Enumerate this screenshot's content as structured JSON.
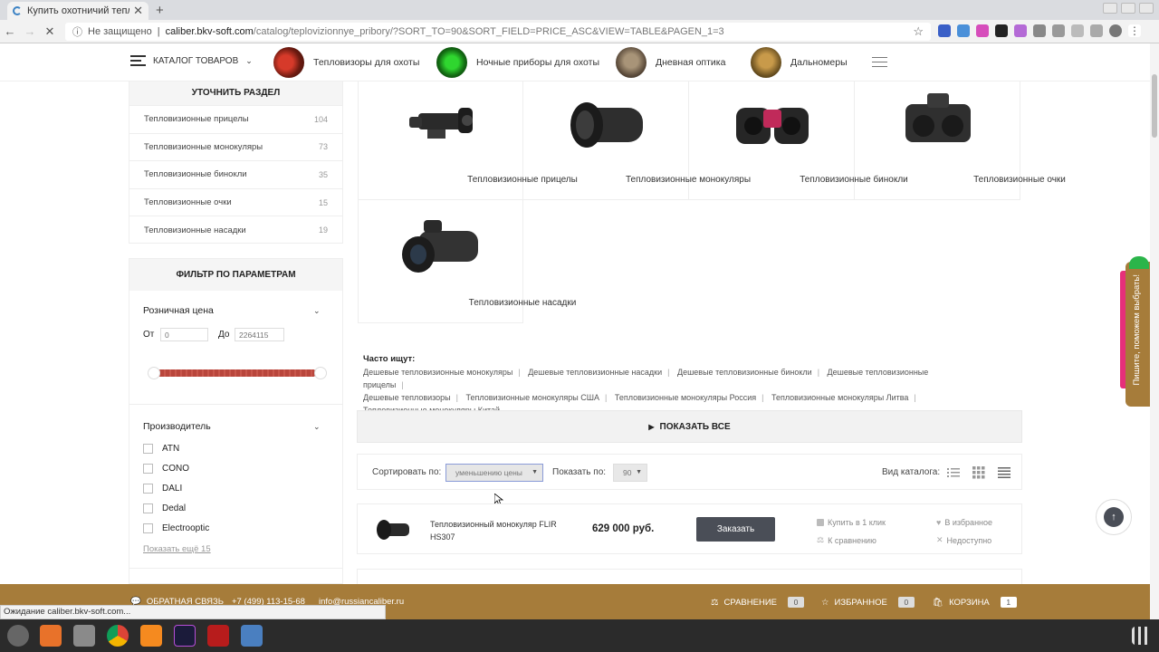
{
  "browser": {
    "tab_title": "Купить охотничий тепло",
    "new_tab": "+",
    "insecure_label": "Не защищено",
    "url_host": "caliber.bkv-soft.com",
    "url_path": "/catalog/teplovizionnye_pribory/?SORT_TO=90&SORT_FIELD=PRICE_ASC&VIEW=TABLE&PAGEN_1=3",
    "status_text": "Ожидание caliber.bkv-soft.com..."
  },
  "header": {
    "catalog_label": "КАТАЛОГ ТОВАРОВ",
    "nav": [
      {
        "label": "Тепловизоры для охоты",
        "color": "#7a2318"
      },
      {
        "label": "Ночные приборы для охоты",
        "color": "#1f8a1f"
      },
      {
        "label": "Дневная оптика",
        "color": "#6b5a45"
      },
      {
        "label": "Дальномеры",
        "color": "#8a6a30"
      }
    ]
  },
  "sidebar": {
    "section_title": "УТОЧНИТЬ РАЗДЕЛ",
    "categories": [
      {
        "label": "Тепловизионные прицелы",
        "count": "104"
      },
      {
        "label": "Тепловизионные монокуляры",
        "count": "73"
      },
      {
        "label": "Тепловизионные бинокли",
        "count": "35"
      },
      {
        "label": "Тепловизионные очки",
        "count": "15"
      },
      {
        "label": "Тепловизионные насадки",
        "count": "19"
      }
    ],
    "filter_title": "ФИЛЬТР ПО ПАРАМЕТРАМ",
    "price_label": "Розничная цена",
    "from_label": "От",
    "to_label": "До",
    "from_placeholder": "0",
    "to_placeholder": "2264115",
    "manufacturer_label": "Производитель",
    "manufacturers": [
      "ATN",
      "CONO",
      "DALI",
      "Dedal",
      "Electrooptic"
    ],
    "show_more": "Показать ещё 15"
  },
  "grid": {
    "items": [
      {
        "label": "Тепловизионные прицелы"
      },
      {
        "label": "Тепловизионные монокуляры"
      },
      {
        "label": "Тепловизионные бинокли"
      },
      {
        "label": "Тепловизионные очки"
      },
      {
        "label": "Тепловизионные насадки"
      }
    ]
  },
  "frequent": {
    "title": "Часто ищут:",
    "links": [
      "Дешевые тепловизионные монокуляры",
      "Дешевые тепловизионные насадки",
      "Дешевые тепловизионные бинокли",
      "Дешевые тепловизионные прицелы",
      "Дешевые тепловизоры",
      "Тепловизионные монокуляры США",
      "Тепловизионные монокуляры Россия",
      "Тепловизионные монокуляры Литва",
      "Тепловизионные монокуляры Китай"
    ]
  },
  "show_all": "ПОКАЗАТЬ ВСЕ",
  "sort": {
    "sort_label": "Сортировать по:",
    "sort_value": "уменьшению цены",
    "show_label": "Показать по:",
    "show_value": "90",
    "view_label": "Вид каталога:"
  },
  "product": {
    "name": "Тепловизионный монокуляр FLIR HS307",
    "price": "629 000 руб.",
    "order": "Заказать",
    "one_click": "Купить в 1 клик",
    "compare": "К сравнению",
    "favorite": "В избранное",
    "availability": "Недоступно"
  },
  "help_tab": "Пишите, поможем выбрать!",
  "footer": {
    "feedback": "ОБРАТНАЯ СВЯЗЬ",
    "phone": "+7 (499) 113-15-68",
    "email": "info@russiancaliber.ru",
    "compare": "СРАВНЕНИЕ",
    "compare_count": "0",
    "favorites": "ИЗБРАННОЕ",
    "favorites_count": "0",
    "cart": "КОРЗИНА",
    "cart_count": "1"
  },
  "colors": {
    "footer_bg": "#a67c3a",
    "button_dark": "#4a4e57",
    "slider": "#b9463c"
  }
}
